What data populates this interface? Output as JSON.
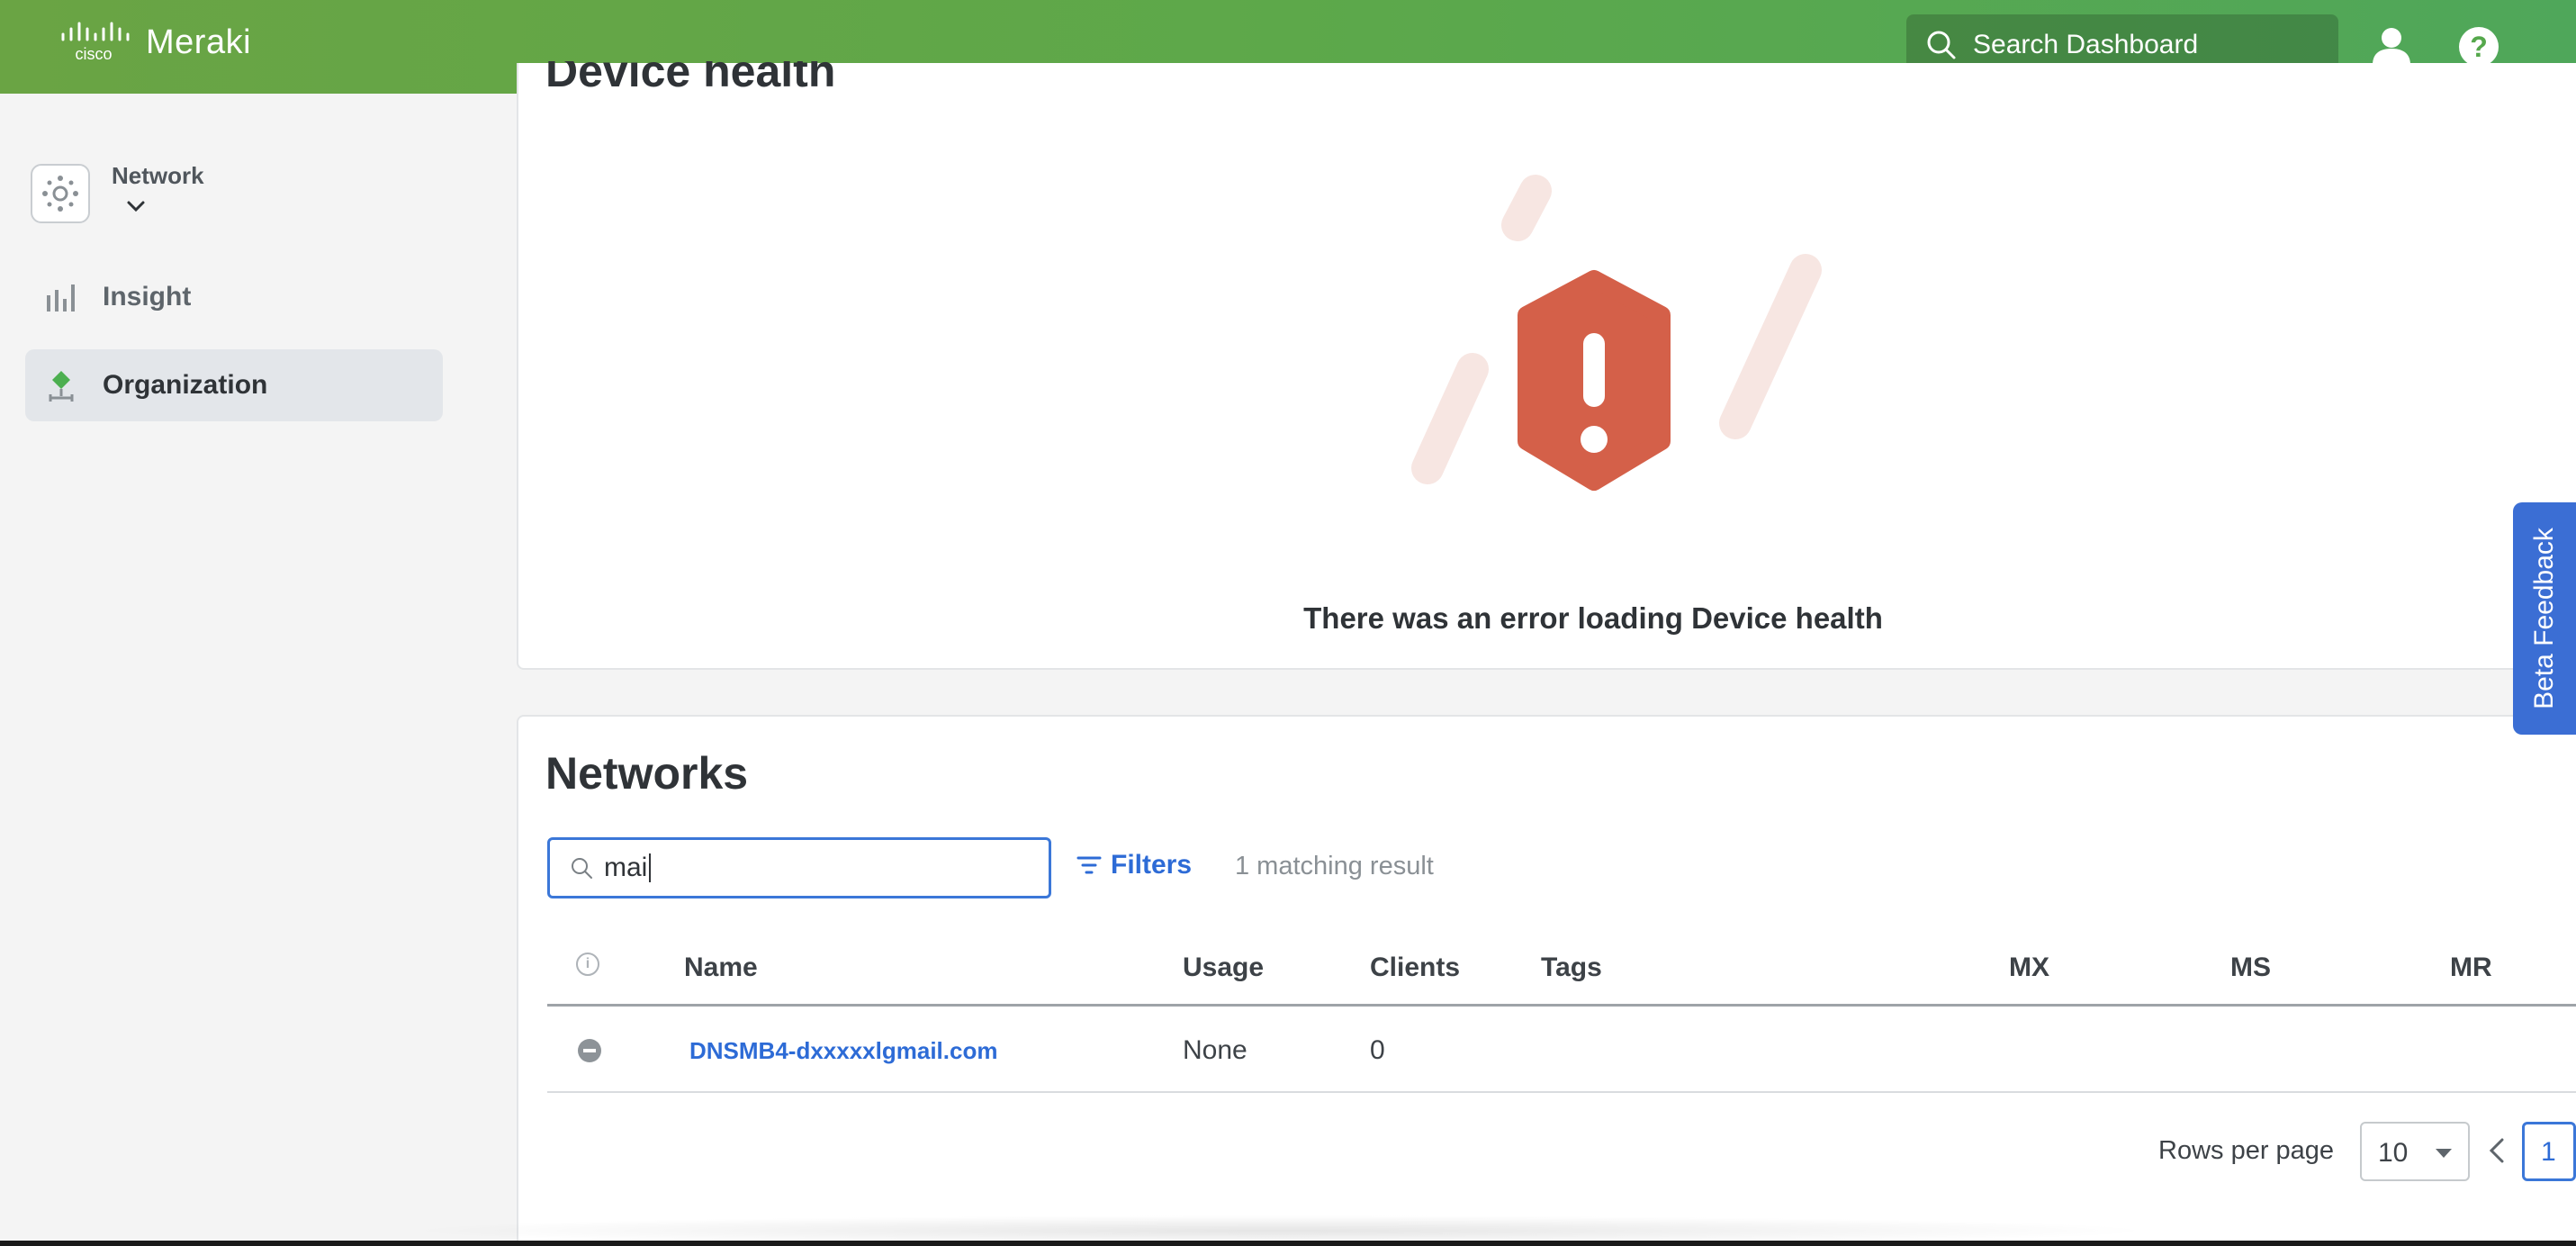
{
  "topbar": {
    "brand_small": "cisco",
    "brand": "Meraki",
    "search_placeholder": "Search Dashboard",
    "help_glyph": "?",
    "icons": [
      "cisco-logo",
      "search-icon",
      "user-icon",
      "help-icon"
    ],
    "colors": {
      "bar_start": "#6aa444",
      "bar_end": "#4fa75a"
    }
  },
  "sidebar": {
    "network_label": "Network",
    "items": [
      {
        "label": "Insight",
        "icon": "bar-chart-icon",
        "active": false
      },
      {
        "label": "Organization",
        "icon": "organization-icon",
        "active": true
      }
    ]
  },
  "device_health": {
    "title": "Device health",
    "error_message": "There was an error loading Device health",
    "error_color": "#d46049"
  },
  "networks": {
    "title": "Networks",
    "search_value": "mai",
    "filters_label": "Filters",
    "match_count": "1 matching result",
    "columns": [
      "Name",
      "Usage",
      "Clients",
      "Tags",
      "MX",
      "MS",
      "MR"
    ],
    "rows": [
      {
        "name": "DNSMB4-dxxxxxlgmail.com",
        "usage": "None",
        "clients": "0",
        "tags": "",
        "mx": "",
        "ms": "",
        "mr": ""
      }
    ],
    "rows_per_page_label": "Rows per page",
    "rows_per_page": "10",
    "current_page": "1"
  },
  "feedback": {
    "label": "Beta Feedback",
    "color": "#3b6ed4"
  }
}
